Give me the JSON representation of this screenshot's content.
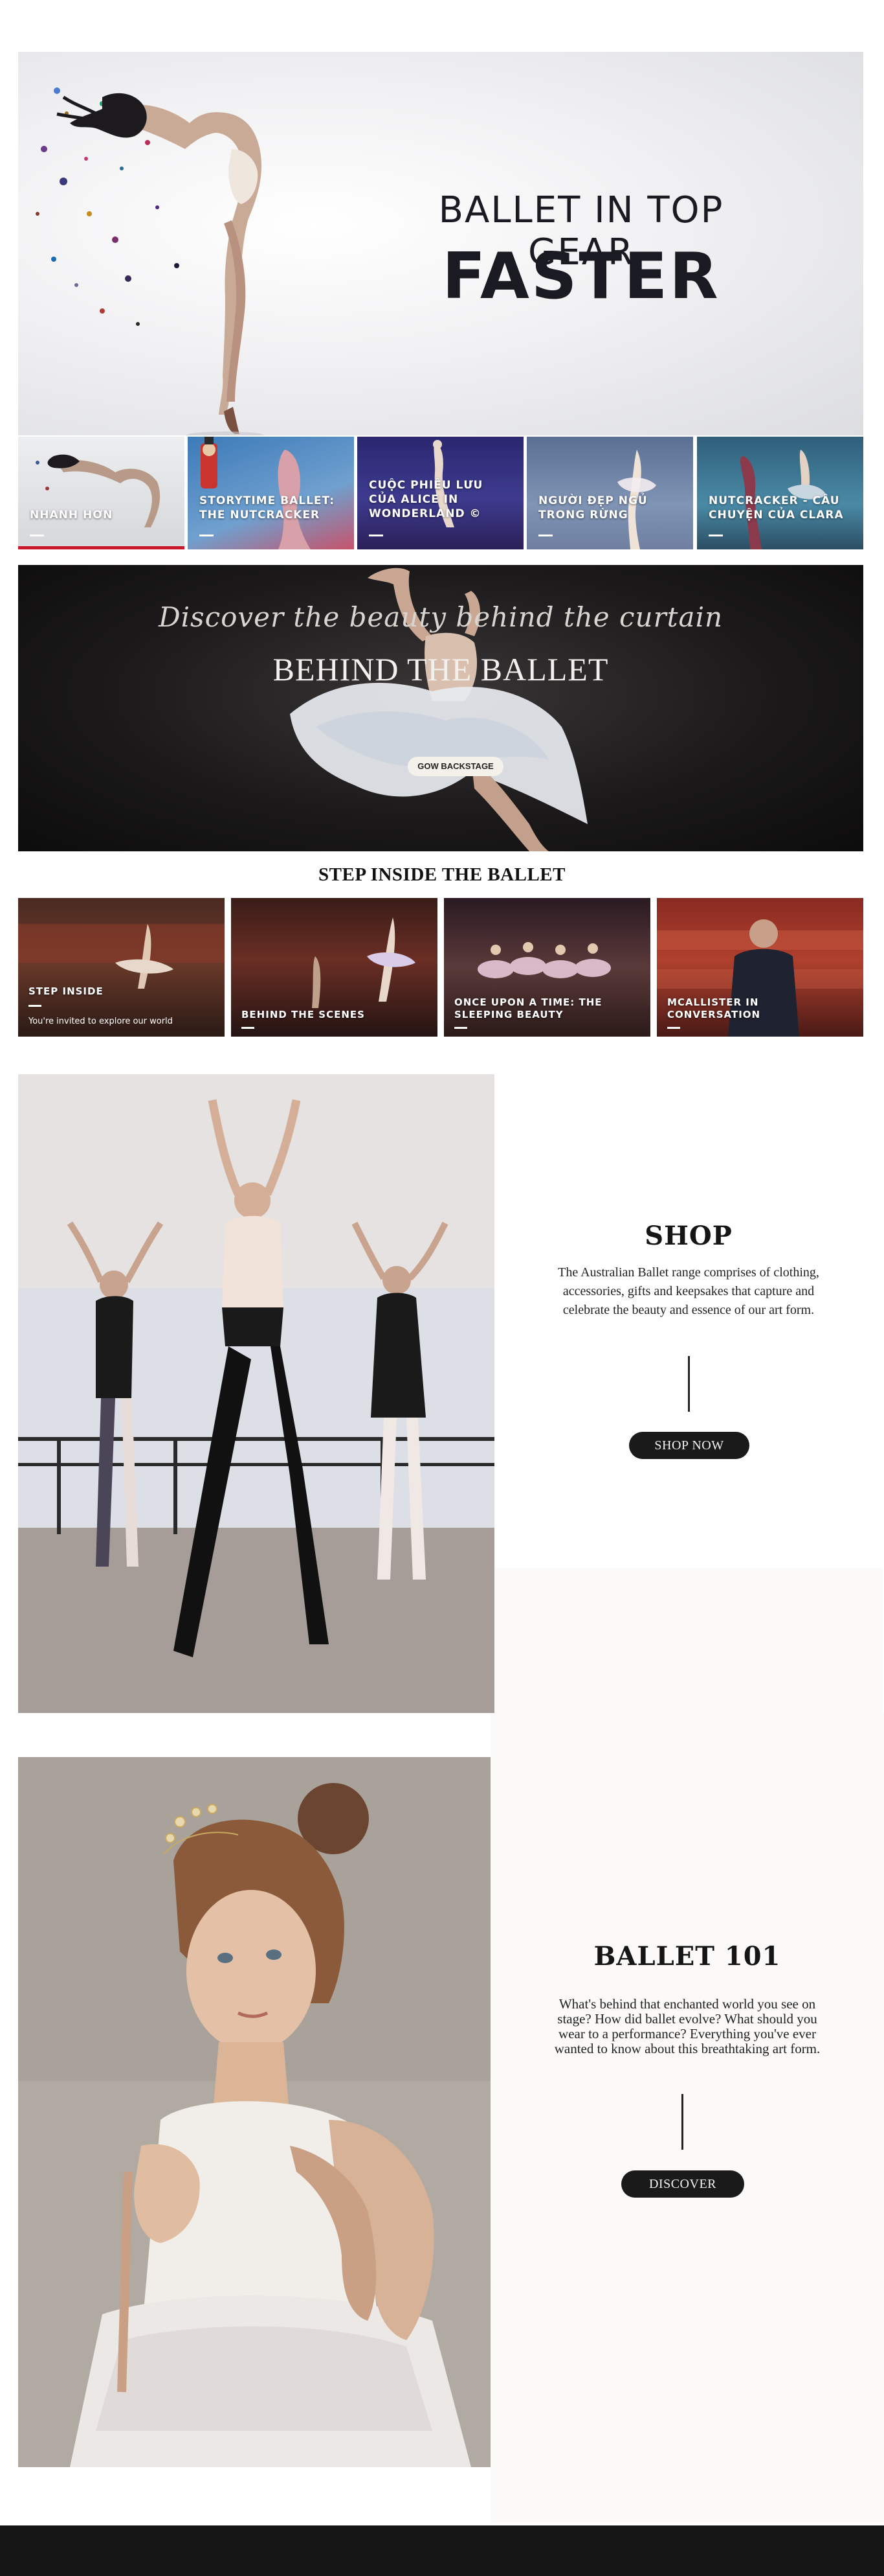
{
  "hero": {
    "line1": "BALLET IN TOP GEAR",
    "line2": "FASTER"
  },
  "thumbnails": [
    {
      "label": "NHANH HƠN",
      "active": true
    },
    {
      "label": "STORYTIME BALLET: THE NUTCRACKER",
      "active": false
    },
    {
      "label": "CUỘC PHIÊU LƯU CỦA ALICE IN WONDERLAND ©",
      "active": false
    },
    {
      "label": "NGƯỜI ĐẸP NGỦ TRONG RỪNG",
      "active": false
    },
    {
      "label": "NUTCRACKER - CÂU CHUYỆN CỦA CLARA",
      "active": false
    }
  ],
  "behind": {
    "script": "Discover the beauty behind the curtain",
    "title": "BEHIND THE BALLET",
    "button": "GOW BACKSTAGE"
  },
  "step_inside": {
    "heading": "STEP INSIDE THE BALLET",
    "cards": [
      {
        "label": "STEP INSIDE",
        "sub": "You're invited to explore our world"
      },
      {
        "label": "BEHIND THE SCENES",
        "sub": ""
      },
      {
        "label": "ONCE UPON A TIME: THE SLEEPING BEAUTY",
        "sub": ""
      },
      {
        "label": "MCALLISTER IN CONVERSATION",
        "sub": ""
      }
    ]
  },
  "shop": {
    "title": "SHOP",
    "description": "The Australian Ballet range comprises of clothing, accessories, gifts and keepsakes that capture and celebrate the beauty and essence of our art form.",
    "button": "SHOP NOW"
  },
  "ballet101": {
    "title": "BALLET 101",
    "description": "What's behind that enchanted world you see on stage? How did ballet evolve? What should you wear to a performance? Everything you've ever wanted to know about this breathtaking art form.",
    "button": "DISCOVER"
  },
  "colors": {
    "accent_red": "#c9182b",
    "dark": "#1a1a1a",
    "hero_text": "#1a1a22"
  }
}
